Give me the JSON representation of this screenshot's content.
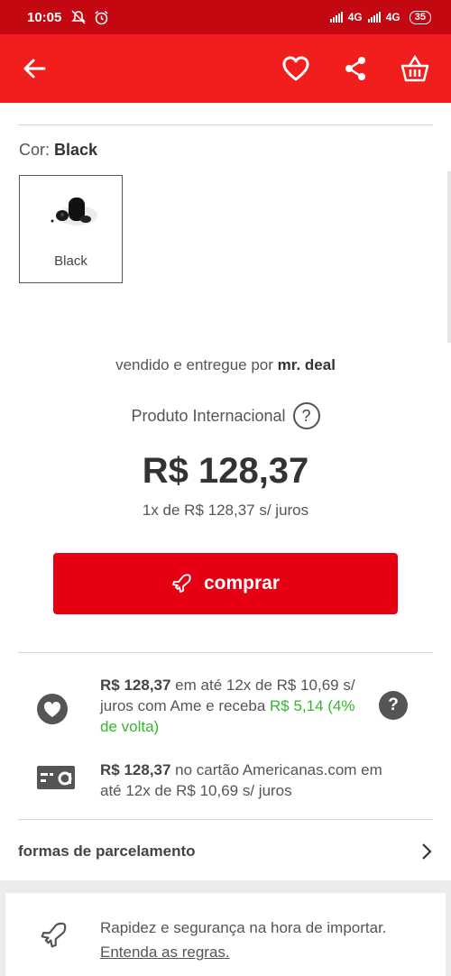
{
  "status_bar": {
    "time": "10:05",
    "network_1": "4G",
    "network_2": "4G",
    "battery": "35",
    "icons": [
      "mute-notifications-icon",
      "alarm-icon"
    ]
  },
  "app_bar": {
    "icons": [
      "back-arrow-icon",
      "heart-icon",
      "share-icon",
      "basket-icon"
    ],
    "color": "#f21d1d"
  },
  "product": {
    "color_prefix": "Cor: ",
    "color_value": "Black",
    "swatch_label": "Black",
    "sold_by_prefix": "vendido e entregue por ",
    "seller": "mr. deal",
    "international": "Produto Internacional",
    "help": "?",
    "price": "R$ 128,37",
    "installment": "1x de R$ 128,37 s/ juros"
  },
  "buy_button": {
    "label": "comprar",
    "color": "#e60014"
  },
  "offers": {
    "ame": {
      "price": "R$ 128,37",
      "text": " em até 12x de R$ 10,69 s/ juros com Ame e receba ",
      "cashback": "R$ 5,14 (4% de volta)",
      "cashback_color": "#36b52f"
    },
    "card": {
      "price": "R$ 128,37",
      "text": " no cartão Americanas.com em até 12x de R$ 10,69 s/ juros"
    }
  },
  "installments_link": {
    "label": "formas de parcelamento"
  },
  "import_info": {
    "text": "Rapidez e segurança na hora de importar.",
    "link": "Entenda as regras."
  }
}
